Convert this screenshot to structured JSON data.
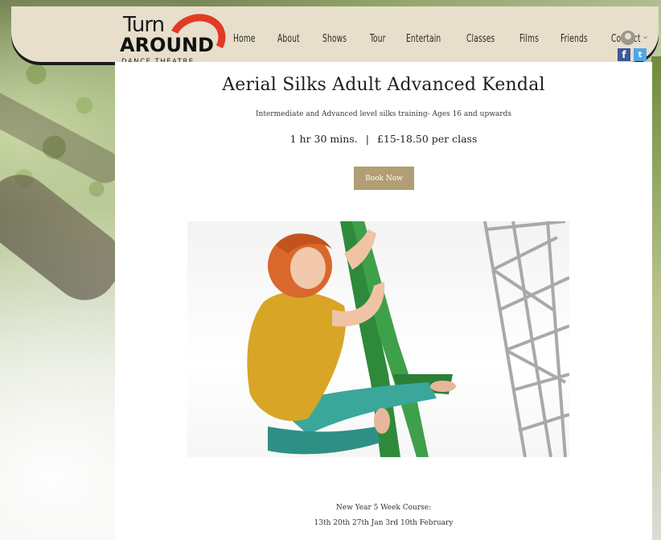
{
  "brand": {
    "logo_top": "Turn",
    "logo_main": "AROUND",
    "logo_sub": "DANCE THEATRE"
  },
  "nav": {
    "items": [
      "Home",
      "About",
      "Shows",
      "Tour",
      "Entertain",
      "Classes",
      "Films",
      "Friends",
      "Contact"
    ]
  },
  "header_icons": {
    "account": "user-avatar-icon",
    "dropdown": "chevron-down-icon",
    "facebook": "f",
    "twitter": "t"
  },
  "service": {
    "title": "Aerial Silks Adult Advanced Kendal",
    "subtitle": "Intermediate and Advanced level silks training- Ages 16 and upwards",
    "duration": "1 hr 30 mins.",
    "separator": "|",
    "price": "£15-18.50 per class",
    "book_label": "Book Now"
  },
  "course": {
    "line1": "New Year 5 Week Course:",
    "line2": "13th 20th 27th Jan 3rd 10th February"
  },
  "colors": {
    "header_bg": "#e7dfcb",
    "accent": "#b19e74",
    "logo_red": "#e33b23",
    "silk_green": "#2e8a3a"
  }
}
